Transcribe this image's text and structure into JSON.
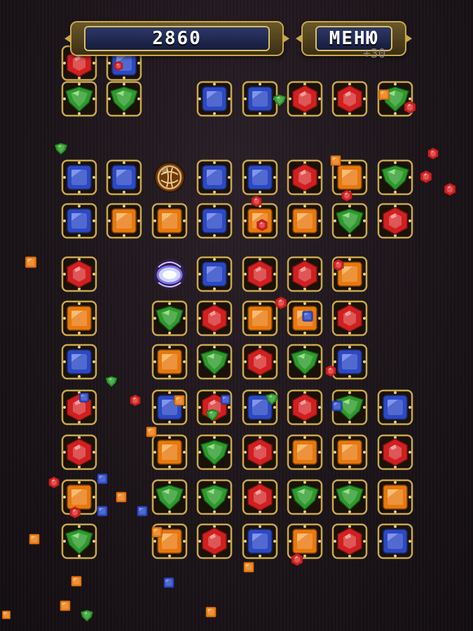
{
  "hud": {
    "score": "2860",
    "menu_label": "МЕНЮ",
    "score_popup": "+30"
  },
  "colors": {
    "red": "#d21f1f",
    "blue": "#2c49c4",
    "orange": "#e9780c",
    "green": "#2c9a2a",
    "gold_frame": "#c9a84c"
  },
  "board": {
    "columns": 8,
    "rows": 12,
    "grid": [
      [
        "red",
        "blue",
        ".",
        ".",
        ".",
        ".",
        ".",
        "."
      ],
      [
        "green",
        "green",
        ".",
        "blue",
        "blue",
        "red",
        "red",
        "green"
      ],
      [
        "blue",
        "blue",
        "bomb",
        "blue",
        "blue",
        "red",
        "orange",
        "green"
      ],
      [
        "blue",
        "orange",
        "orange",
        "blue",
        "orange",
        "orange",
        "green",
        "red"
      ],
      [
        "red",
        ".",
        "vortex",
        "blue",
        "red",
        "red",
        "orange",
        "."
      ],
      [
        "orange",
        ".",
        "green",
        "red",
        "orange",
        "orange",
        "red",
        "."
      ],
      [
        "blue",
        ".",
        "orange",
        "green",
        "red",
        "green",
        "blue",
        "."
      ],
      [
        "red",
        ".",
        "blue",
        "red",
        "blue",
        "red",
        "green",
        "blue"
      ],
      [
        "red",
        ".",
        "orange",
        "green",
        "red",
        "orange",
        "orange",
        "red"
      ],
      [
        "orange",
        ".",
        "green",
        "green",
        "red",
        "green",
        "green",
        "orange"
      ],
      [
        "green",
        ".",
        "orange",
        "red",
        "blue",
        "orange",
        "red",
        "blue"
      ],
      [
        ".",
        ".",
        ".",
        ".",
        ".",
        ".",
        ".",
        "."
      ]
    ]
  },
  "special_icons": [
    "bomb-icon",
    "vortex-icon"
  ]
}
